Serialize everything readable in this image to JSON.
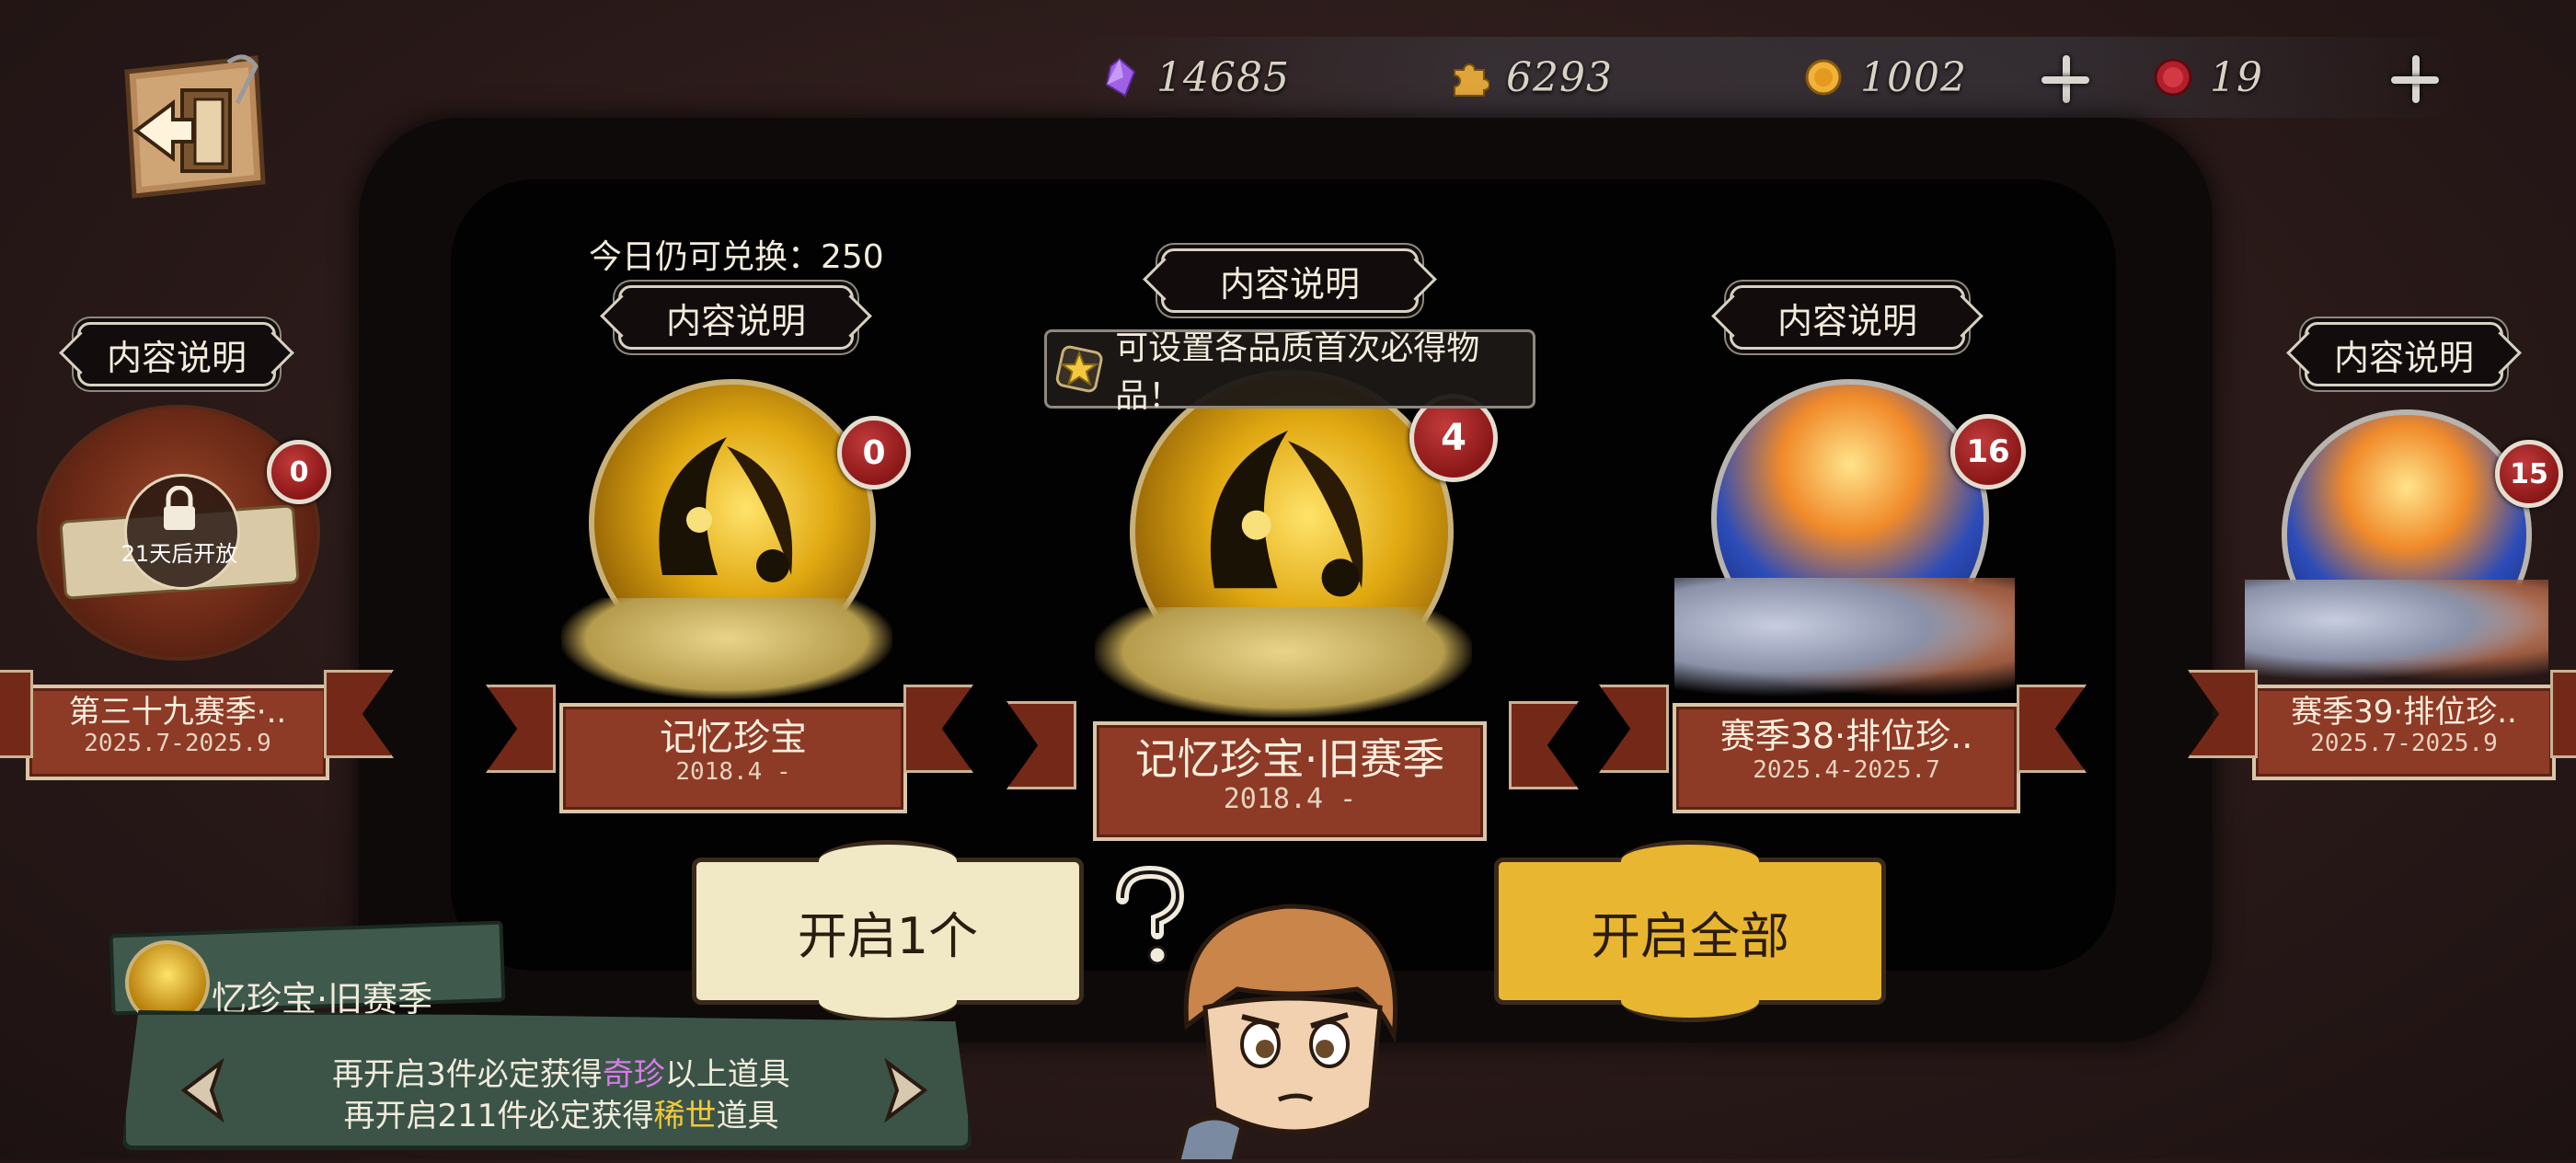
{
  "currencies": {
    "crystal": {
      "icon": "purple-crystal-icon",
      "value": "14685"
    },
    "puzzle": {
      "icon": "puzzle-piece-icon",
      "value": "6293"
    },
    "coin": {
      "icon": "gold-coin-icon",
      "value": "1002"
    },
    "seal": {
      "icon": "red-seal-icon",
      "value": "19"
    }
  },
  "exchange": {
    "label": "今日仍可兑换：250"
  },
  "tooltip": {
    "text": "可设置各品质首次必得物品！"
  },
  "treasures": [
    {
      "label": "内容说明",
      "count": "0",
      "title": "第三十九赛季·..",
      "date": "2025.7-2025.9",
      "lock_text": "21天后开放"
    },
    {
      "label": "内容说明",
      "count": "0",
      "title": "记忆珍宝",
      "date": "2018.4 -"
    },
    {
      "label": "内容说明",
      "count": "4",
      "title": "记忆珍宝·旧赛季",
      "date": "2018.4 -"
    },
    {
      "label": "内容说明",
      "count": "16",
      "title": "赛季38·排位珍..",
      "date": "2025.4-2025.7"
    },
    {
      "label": "内容说明",
      "count": "15",
      "title": "赛季39·排位珍..",
      "date": "2025.7-2025.9"
    }
  ],
  "buttons": {
    "open_one": "开启1个",
    "open_all": "开启全部"
  },
  "bottom_panel": {
    "title": "忆珍宝·旧赛季",
    "line1_prefix": "再开启3件必定获得",
    "line1_highlight": "奇珍",
    "line1_suffix": "以上道具",
    "line2_prefix": "再开启211件必定获得",
    "line2_highlight": "稀世",
    "line2_suffix": "道具"
  },
  "colors": {
    "purple_highlight": "#d77be8",
    "yellow_highlight": "#f1c93a",
    "badge_red": "#a32323",
    "ribbon": "#8d3a27"
  }
}
